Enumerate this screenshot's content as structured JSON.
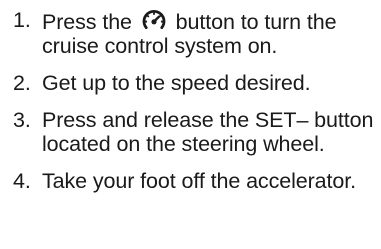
{
  "instructions": {
    "steps": [
      {
        "number": "1.",
        "text_before": "Press the",
        "icon": "cruise-control-speedometer-icon",
        "text_after": "button to turn the cruise control system on."
      },
      {
        "number": "2.",
        "text": "Get up to the speed desired."
      },
      {
        "number": "3.",
        "text": "Press and release the SET– button located on the steering wheel."
      },
      {
        "number": "4.",
        "text": "Take your foot off the accelerator."
      }
    ]
  }
}
